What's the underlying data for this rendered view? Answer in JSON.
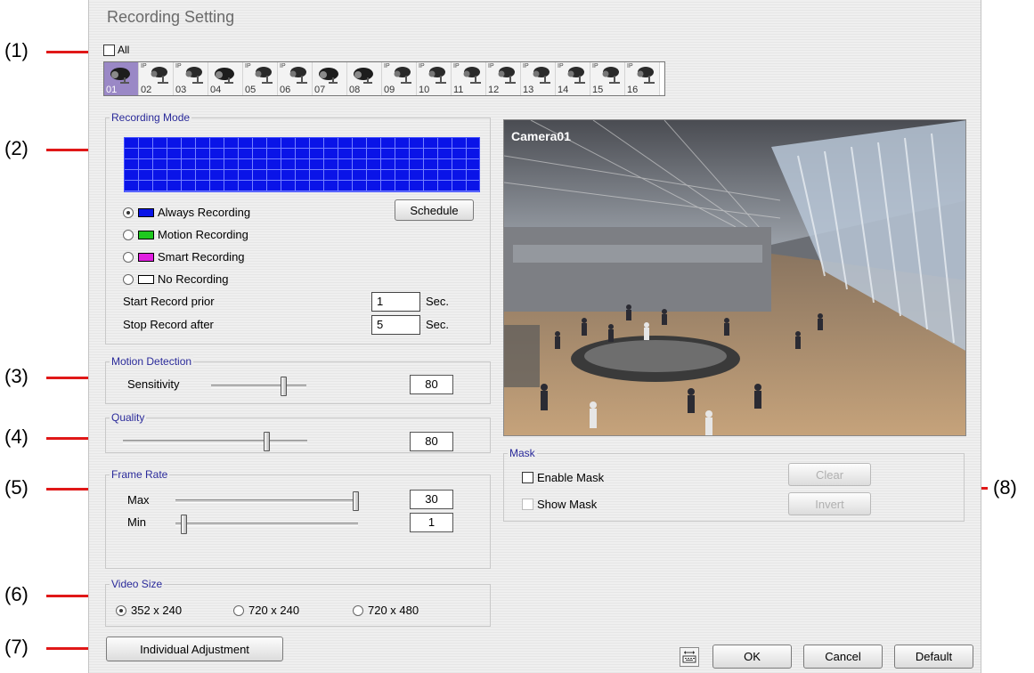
{
  "window": {
    "title": "Recording Setting"
  },
  "callouts": [
    "(1)",
    "(2)",
    "(3)",
    "(4)",
    "(5)",
    "(6)",
    "(7)",
    "(8)"
  ],
  "channels": {
    "all_label": "All",
    "all_checked": false,
    "selected": "01",
    "cameras": [
      {
        "num": "01",
        "ip": false
      },
      {
        "num": "02",
        "ip": true
      },
      {
        "num": "03",
        "ip": true
      },
      {
        "num": "04",
        "ip": false
      },
      {
        "num": "05",
        "ip": true
      },
      {
        "num": "06",
        "ip": true
      },
      {
        "num": "07",
        "ip": false
      },
      {
        "num": "08",
        "ip": false
      },
      {
        "num": "09",
        "ip": true
      },
      {
        "num": "10",
        "ip": true
      },
      {
        "num": "11",
        "ip": true
      },
      {
        "num": "12",
        "ip": true
      },
      {
        "num": "13",
        "ip": true
      },
      {
        "num": "14",
        "ip": true
      },
      {
        "num": "15",
        "ip": true
      },
      {
        "num": "16",
        "ip": true
      }
    ],
    "ip_badge": "IP"
  },
  "recording_mode": {
    "legend": "Recording Mode",
    "schedule_button": "Schedule",
    "options": [
      {
        "label": "Always Recording",
        "color": "#0a14e8",
        "selected": true
      },
      {
        "label": "Motion Recording",
        "color": "#1ec81e",
        "selected": false
      },
      {
        "label": "Smart Recording",
        "color": "#e01ee0",
        "selected": false
      },
      {
        "label": "No Recording",
        "color": "#ffffff",
        "selected": false
      }
    ],
    "start_label": "Start Record prior",
    "start_value": "1",
    "stop_label": "Stop Record after",
    "stop_value": "5",
    "unit": "Sec."
  },
  "motion_detection": {
    "legend": "Motion Detection",
    "label": "Sensitivity",
    "value": "80"
  },
  "quality": {
    "legend": "Quality",
    "value": "80"
  },
  "frame_rate": {
    "legend": "Frame Rate",
    "max_label": "Max",
    "max_value": "30",
    "min_label": "Min",
    "min_value": "1"
  },
  "video_size": {
    "legend": "Video Size",
    "options": [
      {
        "label": "352 x 240",
        "selected": true
      },
      {
        "label": "720 x 240",
        "selected": false
      },
      {
        "label": "720 x 480",
        "selected": false
      }
    ]
  },
  "individual_button": "Individual Adjustment",
  "preview": {
    "camera_name": "Camera01"
  },
  "mask": {
    "legend": "Mask",
    "enable_label": "Enable Mask",
    "show_label": "Show Mask",
    "clear_button": "Clear",
    "invert_button": "Invert"
  },
  "footer": {
    "ok": "OK",
    "cancel": "Cancel",
    "default": "Default",
    "keyboard_icon": "keyboard-icon"
  }
}
